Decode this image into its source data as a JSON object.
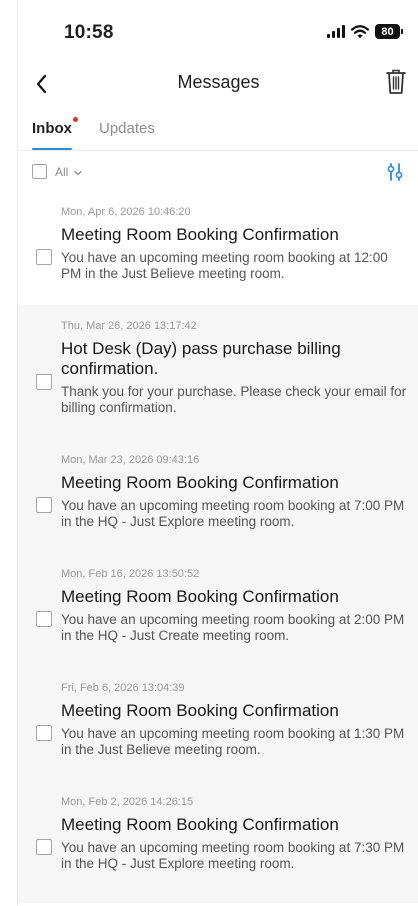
{
  "status_bar": {
    "time": "10:58",
    "battery": "80"
  },
  "nav": {
    "title": "Messages"
  },
  "tabs": [
    {
      "label": "Inbox",
      "active": true,
      "has_dot": true
    },
    {
      "label": "Updates",
      "active": false
    }
  ],
  "filter": {
    "select_label": "All"
  },
  "messages": [
    {
      "date": "Mon, Apr 6, 2026  10:46:20",
      "subject": "Meeting Room Booking Confirmation",
      "body": "You have an upcoming meeting room booking at 12:00 PM in the Just Believe meeting room."
    },
    {
      "date": "Thu, Mar 26, 2026  13:17:42",
      "subject": "Hot Desk (Day) pass purchase billing confirmation.",
      "body": "Thank you for your purchase. Please check your email for billing confirmation."
    },
    {
      "date": "Mon, Mar 23, 2026  09:43:16",
      "subject": "Meeting Room Booking Confirmation",
      "body": "You have an upcoming meeting room booking at 7:00 PM in the HQ - Just Explore meeting room."
    },
    {
      "date": "Mon, Feb 16, 2026  13:50:52",
      "subject": "Meeting Room Booking Confirmation",
      "body": "You have an upcoming meeting room booking at 2:00 PM in the HQ - Just Create meeting room."
    },
    {
      "date": "Fri, Feb 6, 2026  13:04:39",
      "subject": "Meeting Room Booking Confirmation",
      "body": "You have an upcoming meeting room booking at 1:30 PM in the Just Believe meeting room."
    },
    {
      "date": "Mon, Feb 2, 2026  14:26:15",
      "subject": "Meeting Room Booking Confirmation",
      "body": "You have an upcoming meeting room booking at 7:30 PM in the HQ - Just Explore meeting room."
    }
  ]
}
